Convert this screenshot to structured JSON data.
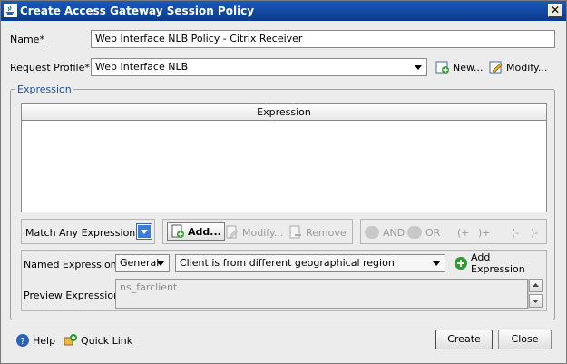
{
  "window": {
    "title": "Create Access Gateway Session Policy",
    "close_glyph": "✕"
  },
  "form": {
    "name_label": "Name",
    "name_required": "*",
    "name_value": "Web Interface NLB Policy - Citrix Receiver",
    "profile_label": "Request Profile*",
    "profile_value": "Web Interface NLB",
    "new_label": "New...",
    "modify_label": "Modify..."
  },
  "expression_group": {
    "legend": "Expression",
    "table_header": "Expression",
    "match_label": "Match Any Expression",
    "add_label": "Add...",
    "modify_label": "Modify...",
    "remove_label": "Remove",
    "and_label": "AND",
    "or_label": "OR",
    "paren_plus_open": "(+",
    "paren_plus_close": ")+",
    "paren_minus_open": "(-",
    "paren_minus_close": ")-"
  },
  "named": {
    "label": "Named Expressions",
    "category_value": "General",
    "expression_value": "Client is from different geographical region",
    "add_expression_label": "Add Expression",
    "preview_label": "Preview Expression",
    "preview_value": "ns_farclient"
  },
  "footer": {
    "help_label": "Help",
    "quick_link_label": "Quick Link",
    "create_label": "Create",
    "close_label": "Close"
  },
  "colors": {
    "title_bar": "#0a3a8e",
    "legend": "#1f4e99",
    "disabled_text": "#9a9a9a"
  },
  "icons": [
    "java-icon",
    "close-icon",
    "new-icon",
    "modify-icon",
    "add-icon",
    "remove-icon",
    "dropdown-arrow-icon",
    "add-expression-icon",
    "help-icon",
    "quick-link-icon"
  ]
}
